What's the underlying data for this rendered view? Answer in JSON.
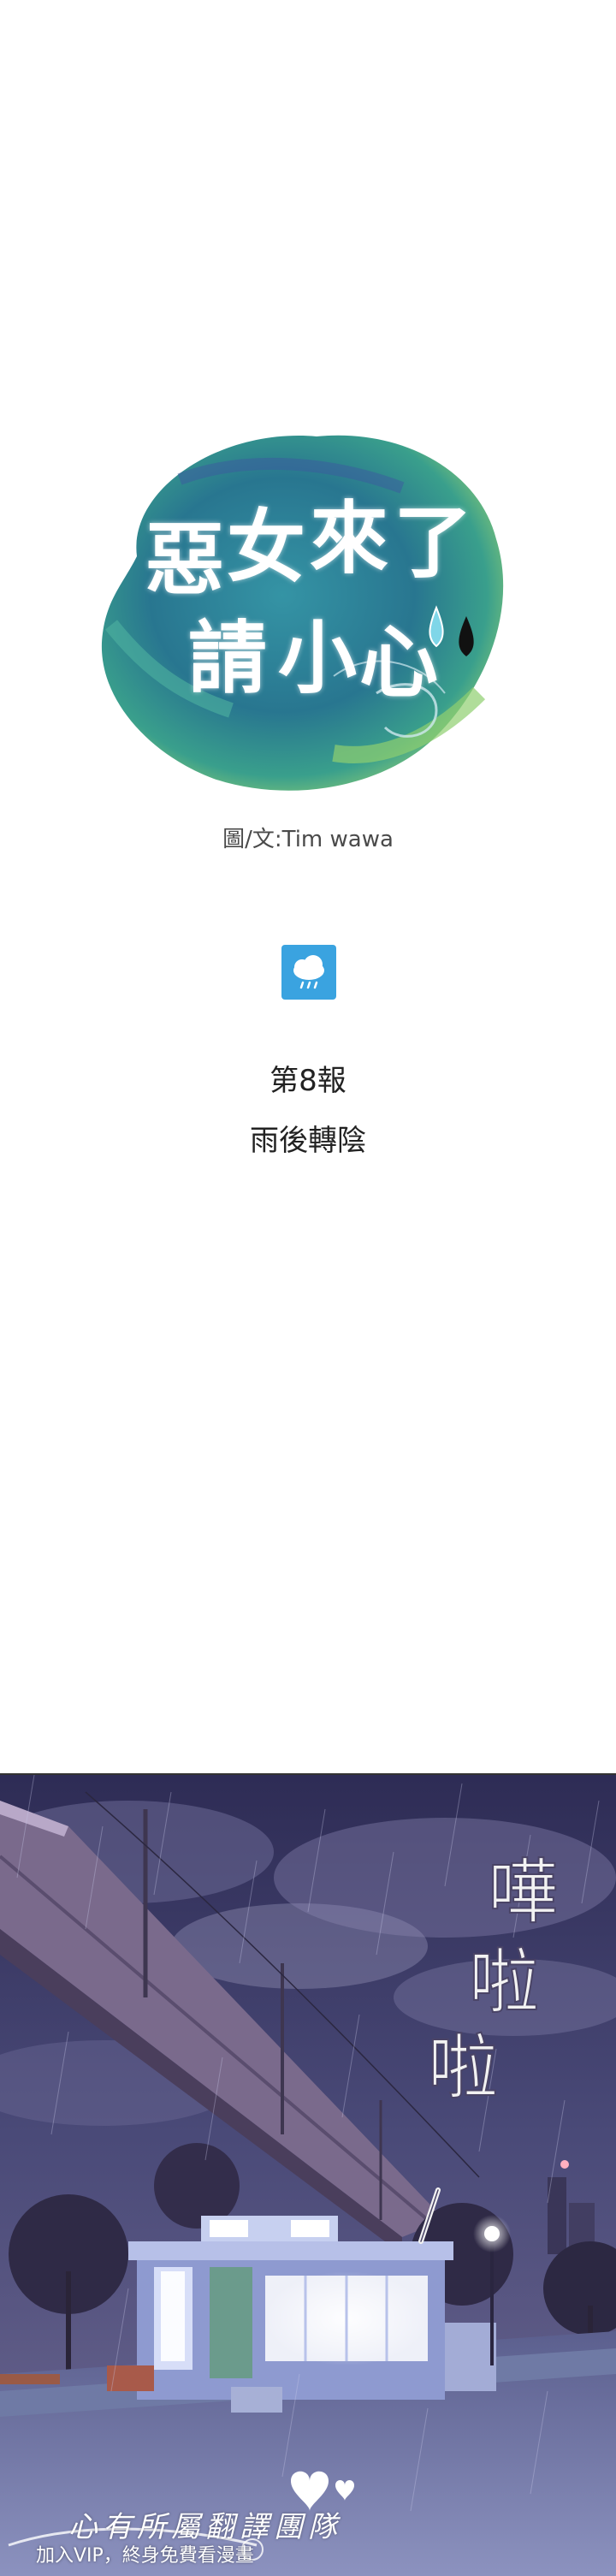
{
  "logo": {
    "title_line1": [
      "惡",
      "女",
      "來",
      "了"
    ],
    "title_line2": [
      "請",
      "小",
      "心"
    ],
    "credit": "圖/文:Tim wawa"
  },
  "weather_icon": "rain-cloud-icon",
  "episode": {
    "number": "第8報",
    "title": "雨後轉陰"
  },
  "scene": {
    "sfx": [
      "嘩",
      "啦",
      "啦"
    ]
  },
  "watermark": {
    "line1": "心有所屬翻譯團隊",
    "line2": "加入VIP，終身免費看漫畫"
  },
  "colors": {
    "badge": "#3aa3e0",
    "sky": "#3d3a66",
    "logo_teal": "#1f8a9a"
  }
}
